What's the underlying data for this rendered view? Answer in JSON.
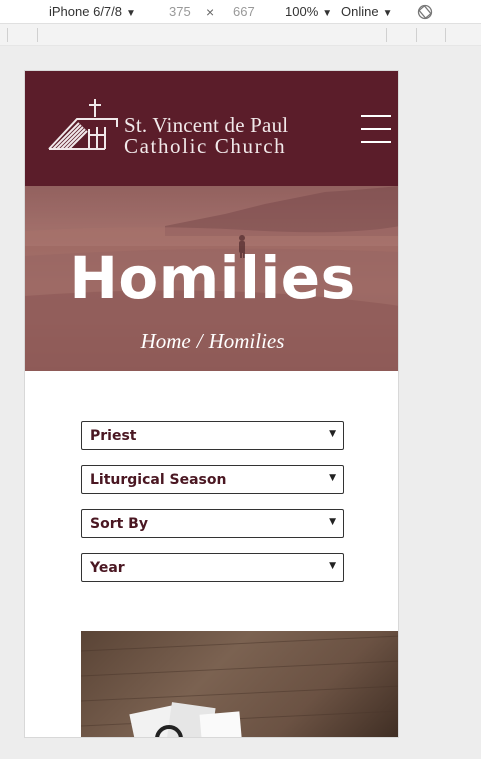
{
  "devtools": {
    "device": "iPhone 6/7/8",
    "width": "375",
    "times": "×",
    "height": "667",
    "zoom": "100%",
    "network": "Online"
  },
  "header": {
    "logo_line1": "St. Vincent de Paul",
    "logo_line2": "Catholic Church",
    "menu_icon": "hamburger-icon"
  },
  "hero": {
    "title": "Homilies",
    "breadcrumb": {
      "home": "Home",
      "separator": "/",
      "current": "Homilies"
    }
  },
  "filters": [
    {
      "label": "Priest"
    },
    {
      "label": "Liturgical Season"
    },
    {
      "label": "Sort By"
    },
    {
      "label": "Year"
    }
  ],
  "colors": {
    "brand": "#5b1d2a",
    "filter_text": "#4a1722"
  }
}
